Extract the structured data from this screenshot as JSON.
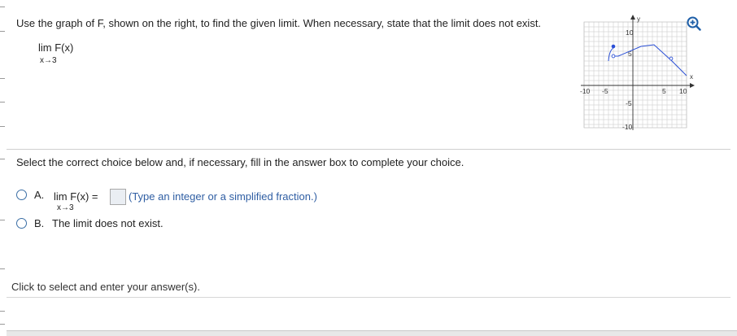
{
  "question": {
    "prompt": "Use the graph of F, shown on the right, to find the given limit. When necessary, state that the limit does not exist.",
    "limit_expr": "lim F(x)",
    "limit_sub": "x→3"
  },
  "graph": {
    "y_label": "y",
    "x_label": "x",
    "tick_labels": {
      "y_top": "10",
      "y_mid": "5",
      "y_neg5": "-5",
      "y_neg10": "-10",
      "x_neg10": "-10",
      "x_neg5": "-5",
      "x_5": "5",
      "x_10": "10"
    },
    "axis_color": "#333333",
    "curve_color": "#2a4fd6",
    "grid_color": "#d6d6d6"
  },
  "instruction": "Select the correct choice below and, if necessary, fill in the answer box to complete your choice.",
  "choices": {
    "a": {
      "letter": "A.",
      "lim": "lim F(x) =",
      "sub": "x→3",
      "hint": "(Type an integer or a simplified fraction.)"
    },
    "b": {
      "letter": "B.",
      "text": "The limit does not exist."
    }
  },
  "status": {
    "text": "Click to select and enter your answer(s)."
  },
  "icons": {
    "zoom": "zoom-in-icon"
  }
}
